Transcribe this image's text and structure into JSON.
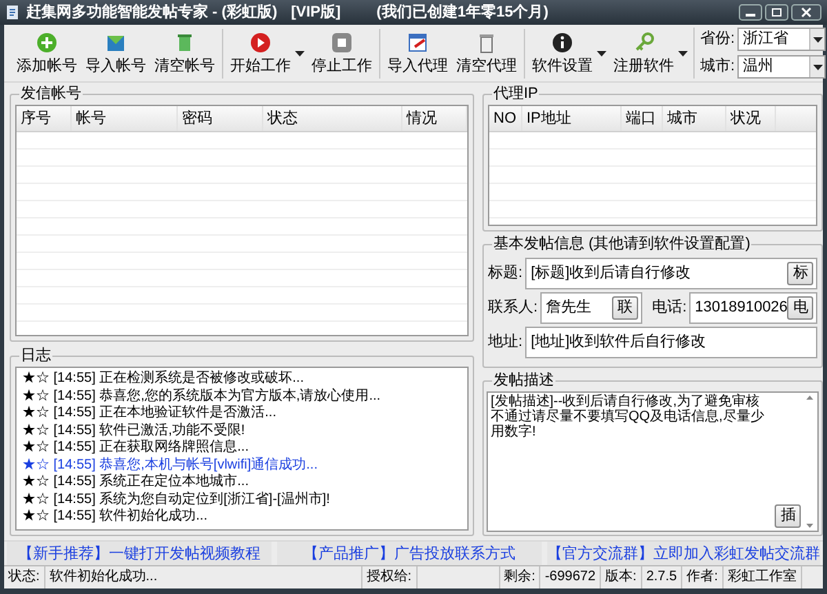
{
  "window": {
    "title": "赶集网多功能智能发帖专家 - (彩虹版)",
    "edition": "[VIP版]",
    "notice": "(我们已创建1年零15个月)"
  },
  "toolbar": {
    "groups": [
      [
        {
          "label": "添加帐号",
          "dropdown": false
        },
        {
          "label": "导入帐号",
          "dropdown": false
        },
        {
          "label": "清空帐号",
          "dropdown": false
        }
      ],
      [
        {
          "label": "开始工作",
          "dropdown": true
        },
        {
          "label": "停止工作",
          "dropdown": false
        }
      ],
      [
        {
          "label": "导入代理",
          "dropdown": false
        },
        {
          "label": "清空代理",
          "dropdown": false
        }
      ],
      [
        {
          "label": "软件设置",
          "dropdown": true
        },
        {
          "label": "注册软件",
          "dropdown": true
        }
      ]
    ],
    "province": {
      "label": "省份:",
      "value": "浙江省"
    },
    "city": {
      "label": "城市:",
      "value": "温州"
    }
  },
  "accounts": {
    "title": "发信帐号",
    "columns": [
      "序号",
      "帐号",
      "密码",
      "状态",
      "情况"
    ]
  },
  "log": {
    "title": "日志",
    "entries": [
      {
        "marker": "★☆",
        "time": "[14:55]",
        "text": "正在检测系统是否被修改或破坏...",
        "color": "#000000"
      },
      {
        "marker": "★☆",
        "time": "[14:55]",
        "text": "恭喜您,您的系统版本为官方版本,请放心使用...",
        "color": "#000000"
      },
      {
        "marker": "★☆",
        "time": "[14:55]",
        "text": "正在本地验证软件是否激活...",
        "color": "#000000"
      },
      {
        "marker": "★☆",
        "time": "[14:55]",
        "text": "软件已激活,功能不受限!",
        "color": "#000000"
      },
      {
        "marker": "★☆",
        "time": "[14:55]",
        "text": "正在获取网络牌照信息...",
        "color": "#000000"
      },
      {
        "marker": "★☆",
        "time": "[14:55]",
        "text": "恭喜您,本机与帐号[vlwifi]通信成功...",
        "color": "#1a3fe0"
      },
      {
        "marker": "★☆",
        "time": "[14:55]",
        "text": "系统正在定位本地城市...",
        "color": "#000000"
      },
      {
        "marker": "★☆",
        "time": "[14:55]",
        "text": "系统为您自动定位到[浙江省]-[温州市]!",
        "color": "#000000"
      },
      {
        "marker": "★☆",
        "time": "[14:55]",
        "text": "软件初始化成功...",
        "color": "#000000"
      }
    ]
  },
  "proxy": {
    "title": "代理IP",
    "columns": [
      "NO",
      "IP地址",
      "端口",
      "城市",
      "状况"
    ]
  },
  "post_info": {
    "title": "基本发帖信息 (其他请到软件设置配置)",
    "title_field": {
      "label": "标题:",
      "value": "[标题]收到后请自行修改",
      "button": "标"
    },
    "contact": {
      "label": "联系人:",
      "value": "詹先生",
      "button": "联"
    },
    "phone": {
      "label": "电话:",
      "value": "13018910026",
      "button": "电"
    },
    "address": {
      "label": "地址:",
      "value": "[地址]收到软件后自行修改"
    }
  },
  "description": {
    "title": "发帖描述",
    "text": "[发帖描述]--收到后请自行修改,为了避免审核不通过请尽量不要填写QQ及电话信息,尽量少用数字!",
    "button": "插"
  },
  "links": [
    {
      "tag": "【新手推荐】",
      "text": "一键打开发帖视频教程"
    },
    {
      "tag": "【产品推广】",
      "text": "广告投放联系方式"
    },
    {
      "tag": "【官方交流群】",
      "text": "立即加入彩虹发帖交流群"
    }
  ],
  "status_bar": [
    {
      "label": "状态:",
      "value": "软件初始化成功..."
    },
    {
      "label": "授权给:"
    },
    {
      "label": "剩余:",
      "value": "-699672"
    },
    {
      "label": "版本:",
      "value": "2.7.5"
    },
    {
      "label": "作者:",
      "value": "彩虹工作室"
    }
  ]
}
